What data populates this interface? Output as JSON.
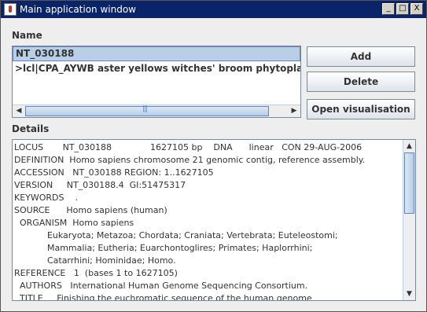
{
  "window": {
    "title": "Main application window",
    "minimize": "_",
    "maximize": "□",
    "close": "X"
  },
  "name_section": {
    "label": "Name",
    "items": [
      "NT_030188",
      ">lcl|CPA_AYWB aster yellows witches' broom phytoplasma com"
    ],
    "selected_index": 0
  },
  "buttons": {
    "add": "Add",
    "delete": "Delete",
    "open_visualisation": "Open visualisation"
  },
  "details_section": {
    "label": "Details",
    "lines": [
      "LOCUS       NT_030188              1627105 bp    DNA      linear   CON 29-AUG-2006",
      "DEFINITION  Homo sapiens chromosome 21 genomic contig, reference assembly.",
      "ACCESSION   NT_030188 REGION: 1..1627105",
      "VERSION     NT_030188.4  GI:51475317",
      "KEYWORDS    .",
      "SOURCE      Homo sapiens (human)",
      "  ORGANISM  Homo sapiens",
      "            Eukaryota; Metazoa; Chordata; Craniata; Vertebrata; Euteleostomi;",
      "            Mammalia; Eutheria; Euarchontoglires; Primates; Haplorrhini;",
      "            Catarrhini; Hominidae; Homo.",
      "REFERENCE   1  (bases 1 to 1627105)",
      "  AUTHORS   International Human Genome Sequencing Consortium.",
      "  TITLE     Finishing the euchromatic sequence of the human genome"
    ]
  },
  "scrollbars": {
    "left_arrow": "◀",
    "right_arrow": "▶",
    "up_arrow": "▲",
    "down_arrow": "▼"
  }
}
